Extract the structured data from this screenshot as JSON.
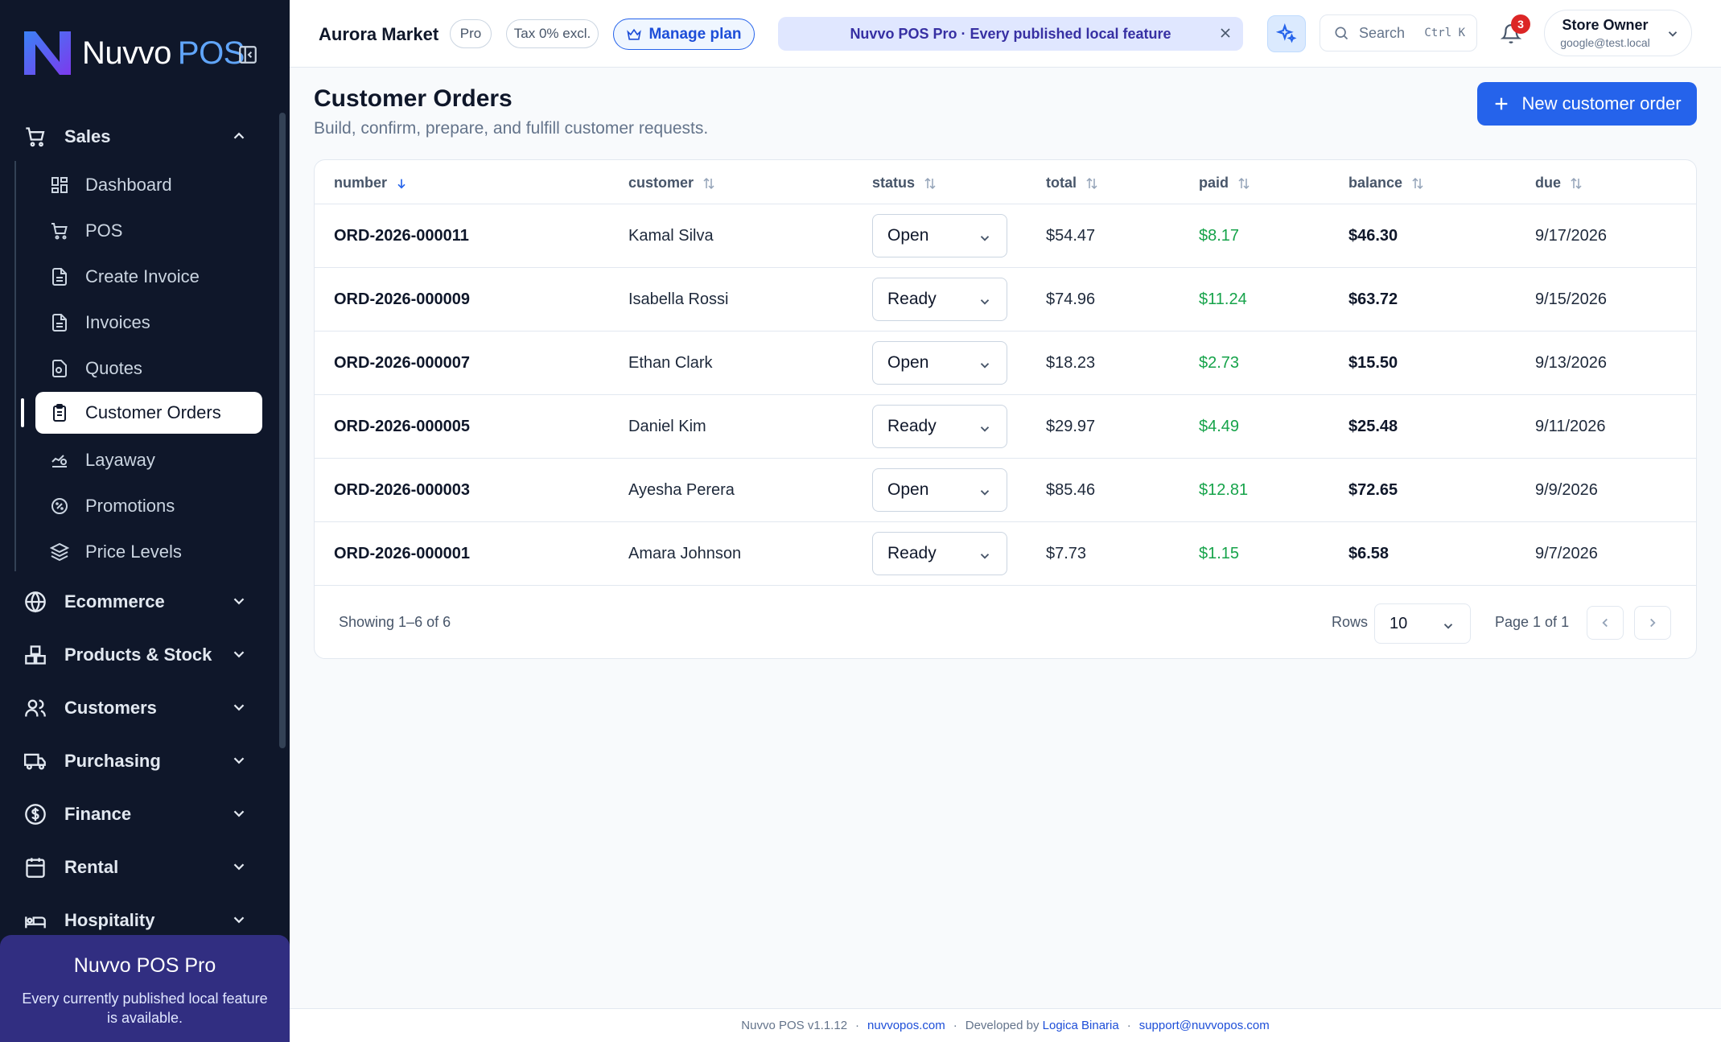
{
  "brand": {
    "name": "Nuvvo",
    "suffix": "POS"
  },
  "sidebar": {
    "sales": {
      "label": "Sales",
      "items": [
        {
          "label": "Dashboard",
          "icon": "dashboard-icon"
        },
        {
          "label": "POS",
          "icon": "cart-icon"
        },
        {
          "label": "Create Invoice",
          "icon": "document-icon"
        },
        {
          "label": "Invoices",
          "icon": "document-icon"
        },
        {
          "label": "Quotes",
          "icon": "quote-icon"
        },
        {
          "label": "Customer Orders",
          "icon": "clipboard-icon",
          "active": true
        },
        {
          "label": "Layaway",
          "icon": "layaway-icon"
        },
        {
          "label": "Promotions",
          "icon": "badge-percent-icon"
        },
        {
          "label": "Price Levels",
          "icon": "layers-icon"
        }
      ]
    },
    "groups": [
      {
        "label": "Ecommerce",
        "icon": "globe-icon"
      },
      {
        "label": "Products & Stock",
        "icon": "boxes-icon"
      },
      {
        "label": "Customers",
        "icon": "users-icon"
      },
      {
        "label": "Purchasing",
        "icon": "truck-icon"
      },
      {
        "label": "Finance",
        "icon": "dollar-icon"
      },
      {
        "label": "Rental",
        "icon": "calendar-icon"
      },
      {
        "label": "Hospitality",
        "icon": "bed-icon"
      }
    ],
    "promo": {
      "title": "Nuvvo POS Pro",
      "desc": "Every currently published local feature is available."
    }
  },
  "topbar": {
    "store_name": "Aurora Market",
    "plan_badge": "Pro",
    "tax_badge": "Tax 0% excl.",
    "manage_plan": "Manage plan",
    "banner": "Nuvvo POS Pro · Every published local feature",
    "search_placeholder": "Search",
    "search_shortcut": "Ctrl K",
    "notification_count": "3",
    "user_name": "Store Owner",
    "user_email": "google@test.local"
  },
  "page": {
    "title": "Customer Orders",
    "subtitle": "Build, confirm, prepare, and fulfill customer requests.",
    "new_button": "New customer order"
  },
  "table": {
    "columns": [
      "number",
      "customer",
      "status",
      "total",
      "paid",
      "balance",
      "due"
    ],
    "rows": [
      {
        "number": "ORD-2026-000011",
        "customer": "Kamal Silva",
        "status": "Open",
        "total": "$54.47",
        "paid": "$8.17",
        "balance": "$46.30",
        "due": "9/17/2026"
      },
      {
        "number": "ORD-2026-000009",
        "customer": "Isabella Rossi",
        "status": "Ready",
        "total": "$74.96",
        "paid": "$11.24",
        "balance": "$63.72",
        "due": "9/15/2026"
      },
      {
        "number": "ORD-2026-000007",
        "customer": "Ethan Clark",
        "status": "Open",
        "total": "$18.23",
        "paid": "$2.73",
        "balance": "$15.50",
        "due": "9/13/2026"
      },
      {
        "number": "ORD-2026-000005",
        "customer": "Daniel Kim",
        "status": "Ready",
        "total": "$29.97",
        "paid": "$4.49",
        "balance": "$25.48",
        "due": "9/11/2026"
      },
      {
        "number": "ORD-2026-000003",
        "customer": "Ayesha Perera",
        "status": "Open",
        "total": "$85.46",
        "paid": "$12.81",
        "balance": "$72.65",
        "due": "9/9/2026"
      },
      {
        "number": "ORD-2026-000001",
        "customer": "Amara Johnson",
        "status": "Ready",
        "total": "$7.73",
        "paid": "$1.15",
        "balance": "$6.58",
        "due": "9/7/2026"
      }
    ],
    "showing": "Showing 1–6 of 6",
    "rows_label": "Rows",
    "rows_value": "10",
    "page_label": "Page 1 of 1"
  },
  "footer": {
    "version": "Nuvvo POS v1.1.12",
    "site": "nuvvopos.com",
    "developed_by": "Developed by",
    "developer": "Logica Binaria",
    "support": "support@nuvvopos.com"
  },
  "colors": {
    "sidebar_bg": "#0f172a",
    "accent": "#2563eb",
    "paid": "#16a34a",
    "promo_bg": "#312e81"
  }
}
